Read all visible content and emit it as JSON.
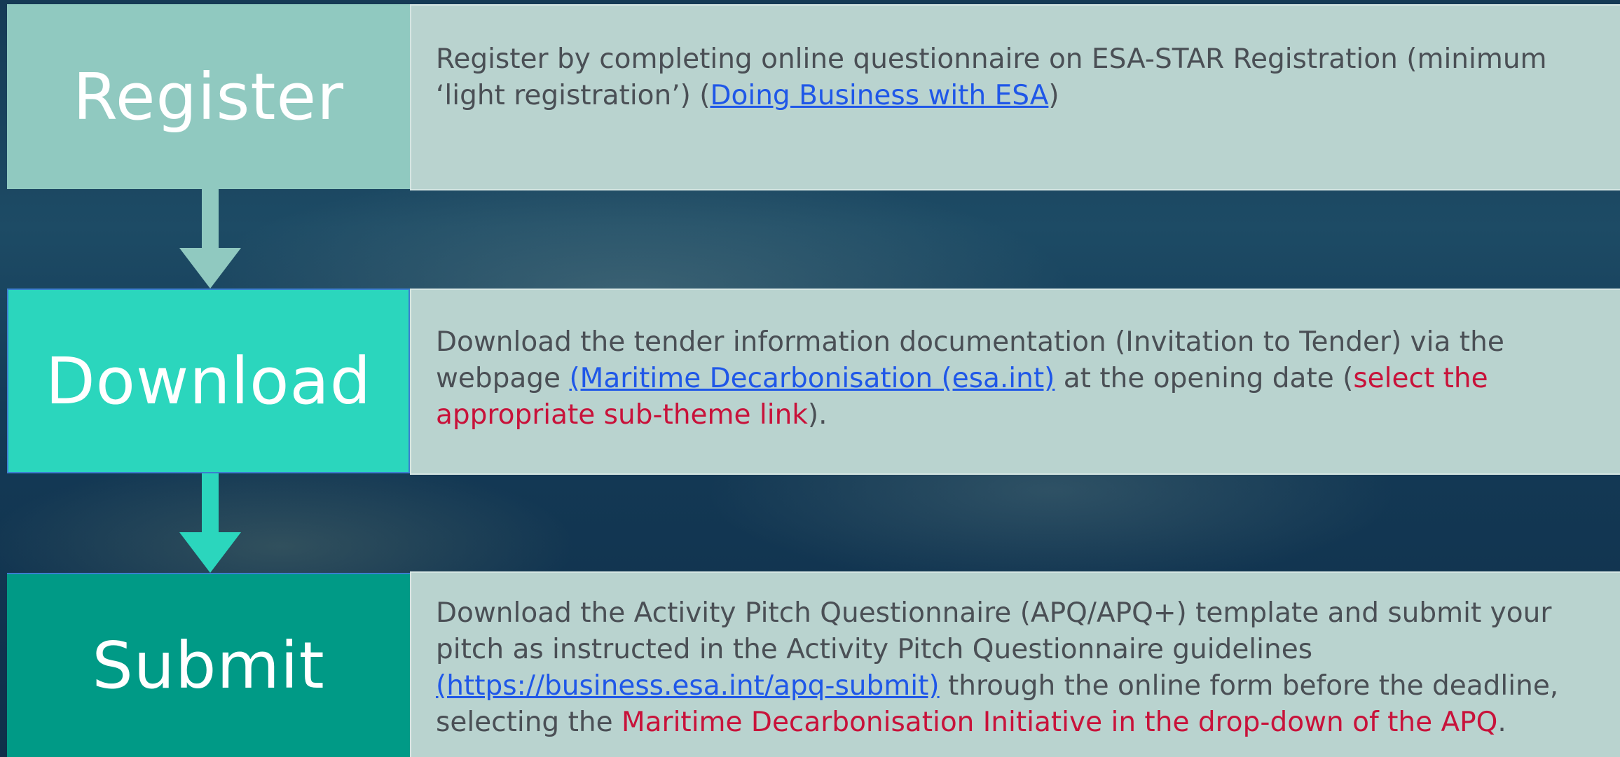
{
  "steps": [
    {
      "label": "Register",
      "color": "#90c9c0",
      "text_1": "Register by completing online questionnaire on ESA-STAR Registration (minimum ‘light registration’) (",
      "link_1": "Doing Business with ESA",
      "text_2": ")"
    },
    {
      "label": "Download",
      "color": "#2bd6bd",
      "text_1": "Download the tender information documentation (Invitation to Tender) via the webpage ",
      "link_1": "(Maritime Decarbonisation (esa.int)",
      "text_2": " at the opening date (",
      "red_1": "select the appropriate sub-theme link",
      "text_3": ")."
    },
    {
      "label": "Submit",
      "color": "#009a86",
      "text_1": "Download the Activity Pitch Questionnaire (APQ/APQ+) template and submit your pitch as instructed in the Activity Pitch Questionnaire guidelines ",
      "link_1": "(https://business.esa.int/apq-submit)",
      "text_2": " through the online form before the deadline, selecting the ",
      "red_1": "Maritime Decarbonisation Initiative in the drop-down of the APQ",
      "text_3": "."
    }
  ],
  "colors": {
    "link": "#1f57e8",
    "highlight": "#c8123a",
    "description_bg": "#b9d3cf"
  }
}
